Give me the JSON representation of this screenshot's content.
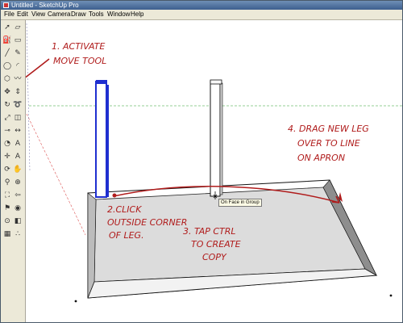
{
  "window": {
    "title": "Untitled - SketchUp Pro"
  },
  "menu": [
    "File",
    "Edit",
    "View",
    "Camera",
    "Draw",
    "Tools",
    "Window",
    "Help"
  ],
  "toolbar": {
    "tools": [
      "select-icon",
      "eraser-icon",
      "paint-bucket-icon",
      "rectangle-icon",
      "line-icon",
      "pencil-icon",
      "circle-icon",
      "arc-icon",
      "polygon-icon",
      "freehand-icon",
      "move-icon",
      "push-pull-icon",
      "rotate-icon",
      "follow-me-icon",
      "scale-icon",
      "offset-icon",
      "tape-measure-icon",
      "dimension-icon",
      "protractor-icon",
      "text-icon",
      "axes-icon",
      "3d-text-icon",
      "orbit-icon",
      "pan-icon",
      "zoom-icon",
      "zoom-window-icon",
      "zoom-extents-icon",
      "previous-view-icon",
      "walk-icon",
      "look-around-icon",
      "position-camera-icon",
      "section-plane-icon",
      "sandbox-icon",
      "footprints-icon"
    ]
  },
  "annotations": {
    "step1_line1": "1. ACTIVATE",
    "step1_line2": "MOVE TOOL",
    "step2_line1": "2.CLICK",
    "step2_line2": "OUTSIDE CORNER",
    "step2_line3": "OF LEG.",
    "step3_line1": "3. TAP CTRL",
    "step3_line2": "TO CREATE",
    "step3_line3": "COPY",
    "step4_line1": "4. DRAG NEW LEG",
    "step4_line2": "OVER TO LINE",
    "step4_line3": "ON APRON"
  },
  "tooltip": {
    "text": "On Face in Group"
  },
  "colors": {
    "annotation": "#b01c1c",
    "selection": "#1f2fd0",
    "axis_green": "#2aa02a"
  }
}
